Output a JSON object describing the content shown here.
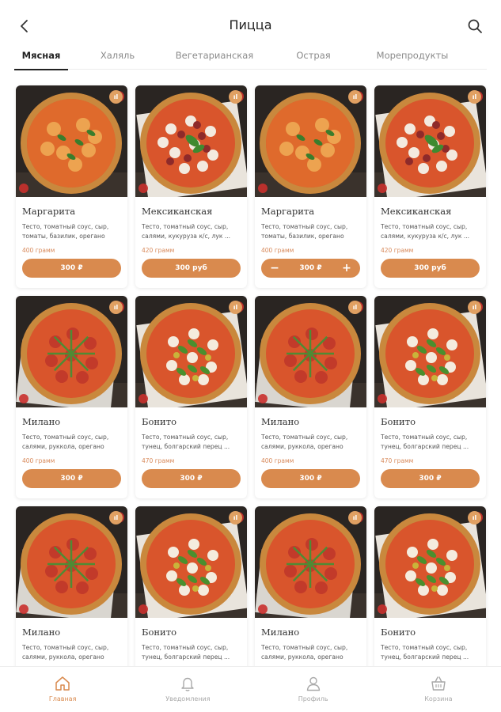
{
  "header": {
    "title": "Пицца",
    "back_icon": "chevron-left-icon",
    "search_icon": "search-icon"
  },
  "tabs": [
    {
      "label": "Мясная",
      "active": true
    },
    {
      "label": "Халяль",
      "active": false
    },
    {
      "label": "Вегетарианская",
      "active": false
    },
    {
      "label": "Острая",
      "active": false
    },
    {
      "label": "Морепродукты",
      "active": false
    }
  ],
  "colors": {
    "accent": "#d98a4e",
    "weight_text": "#d8895a",
    "badge": "#e0a062"
  },
  "badge_text": "ıl",
  "products": [
    {
      "name": "Маргарита",
      "desc": "Тесто, томатный соус, сыр, томаты, базилик, орегано",
      "weight": "400 грамм",
      "price": "300 ₽",
      "control": "button",
      "image": "margherita"
    },
    {
      "name": "Мексиканская",
      "desc": "Тесто, томатный соус, сыр, салями, кукуруза к/с, лук ...",
      "weight": "420 грамм",
      "price": "300 руб",
      "control": "button",
      "image": "mexican"
    },
    {
      "name": "Маргарита",
      "desc": "Тесто, томатный соус, сыр, томаты, базилик, орегано",
      "weight": "400 грамм",
      "price": "300 ₽",
      "control": "stepper",
      "minus": "−",
      "plus": "+",
      "image": "margherita"
    },
    {
      "name": "Мексиканская",
      "desc": "Тесто, томатный соус, сыр, салями, кукуруза к/с, лук ...",
      "weight": "420 грамм",
      "price": "300 руб",
      "control": "button",
      "image": "mexican"
    },
    {
      "name": "Милано",
      "desc": "Тесто, томатный соус, сыр, салями, руккола, орегано",
      "weight": "400 грамм",
      "price": "300 ₽",
      "control": "button",
      "image": "milano"
    },
    {
      "name": "Бонито",
      "desc": "Тесто, томатный соус, сыр, тунец, болгарский перец ...",
      "weight": "470 грамм",
      "price": "300 ₽",
      "control": "button",
      "image": "bonito"
    },
    {
      "name": "Милано",
      "desc": "Тесто, томатный соус, сыр, салями, руккола, орегано",
      "weight": "400 грамм",
      "price": "300 ₽",
      "control": "button",
      "image": "milano"
    },
    {
      "name": "Бонито",
      "desc": "Тесто, томатный соус, сыр, тунец, болгарский перец ...",
      "weight": "470 грамм",
      "price": "300 ₽",
      "control": "button",
      "image": "bonito"
    },
    {
      "name": "Милано",
      "desc": "Тесто, томатный соус, сыр, салями, руккола, орегано",
      "weight": "",
      "price": "",
      "control": "none",
      "image": "milano"
    },
    {
      "name": "Бонито",
      "desc": "Тесто, томатный соус, сыр, тунец, болгарский перец ...",
      "weight": "",
      "price": "",
      "control": "none",
      "image": "bonito"
    },
    {
      "name": "Милано",
      "desc": "Тесто, томатный соус, сыр, салями, руккола, орегано",
      "weight": "",
      "price": "",
      "control": "none",
      "image": "milano"
    },
    {
      "name": "Бонито",
      "desc": "Тесто, томатный соус, сыр, тунец, болгарский перец ...",
      "weight": "",
      "price": "",
      "control": "none",
      "image": "bonito"
    }
  ],
  "bottom_nav": [
    {
      "label": "Главная",
      "icon": "home-icon",
      "active": true
    },
    {
      "label": "Уведомления",
      "icon": "bell-icon",
      "active": false
    },
    {
      "label": "Профиль",
      "icon": "user-icon",
      "active": false
    },
    {
      "label": "Корзина",
      "icon": "basket-icon",
      "active": false
    }
  ]
}
